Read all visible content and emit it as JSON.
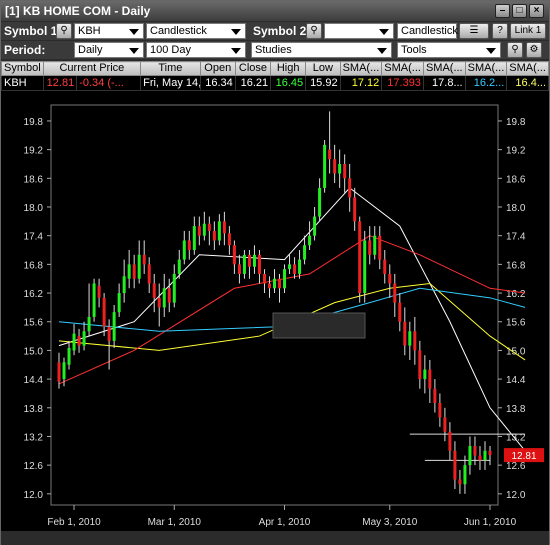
{
  "window": {
    "title": "[1] KB HOME COM - Daily"
  },
  "toolbar1": {
    "symbol1_label": "Symbol 1:",
    "symbol1_value": "KBH",
    "chart_type": "Candlestick",
    "symbol2_label": "Symbol 2:",
    "symbol2_value": "",
    "chart_type2": "Candlestick",
    "help": "?",
    "link": "Link 1"
  },
  "toolbar2": {
    "period_label": "Period:",
    "period_value": "Daily",
    "range_value": "100 Day",
    "studies": "Studies",
    "tools": "Tools"
  },
  "quote_table": {
    "headers": [
      "Symbol",
      "Current Price",
      "Time",
      "Open",
      "Close",
      "High",
      "Low",
      "SMA(...",
      "SMA(...",
      "SMA(...",
      "SMA(...",
      "SMA(..."
    ],
    "row": [
      "KBH",
      "12.81",
      "-0.34 (-...",
      "Fri, May 14,...",
      "16.34",
      "16.21",
      "16.45",
      "15.92",
      "17.12",
      "17.393",
      "17.8...",
      "16.2...",
      "16.4..."
    ],
    "colors": {
      "price": "#ff4040",
      "high": "#3cff3c",
      "sma1": "#ffff33",
      "sma2": "#ff3030",
      "sma3": "#ffffff",
      "sma4": "#33ccff",
      "sma5": "#ffff66"
    }
  },
  "chart_data": {
    "type": "candlestick",
    "title": "",
    "ylim": [
      11.85,
      20.05
    ],
    "y_ticks": [
      "19.8",
      "19.2",
      "18.6",
      "18.0",
      "17.4",
      "16.8",
      "16.2",
      "15.6",
      "15.0",
      "14.4",
      "13.8",
      "13.2",
      "12.6",
      "12.0"
    ],
    "x_ticks": [
      {
        "label": "Feb 1, 2010",
        "i": 3
      },
      {
        "label": "Mar 1, 2010",
        "i": 23
      },
      {
        "label": "Apr 1, 2010",
        "i": 45
      },
      {
        "label": "May 3, 2010",
        "i": 66
      },
      {
        "label": "Jun 1, 2010",
        "i": 86
      }
    ],
    "last_price": "12.81",
    "candles": [
      [
        14.75,
        14.35,
        14.95,
        14.2
      ],
      [
        14.4,
        14.75,
        14.85,
        14.25
      ],
      [
        14.7,
        15.05,
        15.2,
        14.6
      ],
      [
        15.0,
        15.35,
        15.55,
        14.9
      ],
      [
        15.3,
        15.1,
        15.45,
        14.95
      ],
      [
        15.1,
        15.4,
        15.6,
        15.0
      ],
      [
        15.4,
        15.7,
        16.4,
        15.3
      ],
      [
        15.7,
        16.4,
        16.5,
        15.6
      ],
      [
        16.35,
        16.1,
        16.5,
        15.9
      ],
      [
        16.1,
        15.5,
        16.2,
        15.3
      ],
      [
        15.5,
        15.2,
        15.65,
        14.6
      ],
      [
        15.2,
        15.8,
        15.95,
        15.05
      ],
      [
        15.8,
        16.2,
        16.4,
        15.7
      ],
      [
        16.2,
        16.55,
        16.9,
        16.0
      ],
      [
        16.5,
        16.8,
        17.1,
        16.3
      ],
      [
        16.8,
        16.5,
        17.0,
        16.3
      ],
      [
        16.5,
        17.0,
        17.3,
        16.4
      ],
      [
        17.0,
        16.8,
        17.3,
        16.6
      ],
      [
        16.8,
        16.4,
        16.95,
        16.2
      ],
      [
        16.4,
        16.1,
        16.6,
        15.8
      ],
      [
        16.1,
        15.9,
        16.4,
        15.5
      ],
      [
        15.9,
        16.3,
        16.6,
        15.7
      ],
      [
        16.3,
        16.0,
        16.5,
        15.8
      ],
      [
        16.0,
        16.6,
        16.8,
        15.9
      ],
      [
        16.6,
        16.9,
        17.1,
        16.5
      ],
      [
        16.9,
        17.3,
        17.5,
        16.8
      ],
      [
        17.3,
        17.1,
        17.5,
        16.9
      ],
      [
        17.1,
        17.6,
        17.8,
        17.0
      ],
      [
        17.6,
        17.4,
        17.8,
        17.2
      ],
      [
        17.4,
        17.65,
        17.9,
        17.3
      ],
      [
        17.65,
        17.5,
        17.8,
        17.2
      ],
      [
        17.5,
        17.3,
        17.7,
        17.1
      ],
      [
        17.3,
        17.7,
        17.85,
        17.2
      ],
      [
        17.7,
        17.45,
        17.9,
        17.2
      ],
      [
        17.45,
        17.2,
        17.6,
        17.0
      ],
      [
        17.2,
        16.8,
        17.3,
        16.6
      ],
      [
        16.8,
        16.6,
        17.0,
        16.4
      ],
      [
        16.6,
        17.0,
        17.1,
        16.5
      ],
      [
        17.0,
        16.75,
        17.1,
        16.5
      ],
      [
        16.75,
        17.0,
        17.2,
        16.6
      ],
      [
        17.0,
        16.6,
        17.1,
        16.4
      ],
      [
        16.6,
        16.4,
        16.7,
        16.2
      ],
      [
        16.4,
        16.3,
        16.55,
        16.1
      ],
      [
        16.3,
        16.5,
        16.7,
        16.2
      ],
      [
        16.5,
        16.3,
        16.6,
        16.0
      ],
      [
        16.3,
        16.7,
        16.8,
        16.2
      ],
      [
        16.7,
        16.8,
        17.0,
        16.6
      ],
      [
        16.8,
        16.6,
        16.95,
        16.5
      ],
      [
        16.6,
        16.9,
        17.1,
        16.5
      ],
      [
        16.9,
        17.2,
        17.4,
        16.8
      ],
      [
        17.2,
        17.4,
        17.7,
        17.1
      ],
      [
        17.4,
        17.8,
        18.0,
        17.3
      ],
      [
        17.8,
        18.4,
        18.6,
        17.7
      ],
      [
        18.4,
        19.3,
        19.4,
        18.3
      ],
      [
        19.2,
        19.0,
        20.0,
        18.7
      ],
      [
        19.0,
        18.7,
        19.3,
        18.5
      ],
      [
        18.7,
        18.9,
        19.2,
        18.4
      ],
      [
        18.9,
        18.6,
        19.1,
        18.3
      ],
      [
        18.6,
        18.2,
        18.9,
        17.9
      ],
      [
        18.2,
        17.7,
        18.4,
        17.5
      ],
      [
        17.7,
        16.2,
        17.8,
        16.0
      ],
      [
        16.2,
        17.3,
        17.5,
        16.0
      ],
      [
        17.3,
        17.0,
        17.6,
        16.8
      ],
      [
        17.0,
        17.4,
        17.6,
        16.9
      ],
      [
        17.4,
        16.9,
        17.6,
        16.7
      ],
      [
        16.9,
        16.6,
        17.1,
        16.4
      ],
      [
        16.6,
        16.4,
        16.8,
        16.1
      ],
      [
        16.4,
        16.0,
        16.6,
        15.7
      ],
      [
        16.0,
        15.6,
        16.2,
        15.4
      ],
      [
        15.6,
        15.1,
        15.9,
        14.9
      ],
      [
        15.1,
        15.4,
        15.6,
        14.8
      ],
      [
        15.4,
        15.0,
        15.7,
        14.7
      ],
      [
        15.0,
        14.4,
        15.2,
        14.2
      ],
      [
        14.4,
        14.6,
        14.9,
        14.1
      ],
      [
        14.6,
        14.2,
        14.8,
        13.9
      ],
      [
        14.2,
        13.9,
        14.4,
        13.7
      ],
      [
        13.9,
        13.6,
        14.1,
        13.4
      ],
      [
        13.6,
        13.3,
        13.8,
        13.1
      ],
      [
        13.3,
        12.9,
        13.5,
        12.7
      ],
      [
        12.9,
        12.3,
        13.1,
        12.1
      ],
      [
        12.3,
        12.2,
        12.5,
        12.0
      ],
      [
        12.2,
        12.6,
        12.8,
        12.0
      ],
      [
        12.6,
        13.0,
        13.2,
        12.4
      ],
      [
        13.0,
        12.8,
        13.2,
        12.6
      ],
      [
        12.8,
        12.7,
        13.0,
        12.5
      ],
      [
        12.7,
        12.9,
        13.1,
        12.5
      ],
      [
        12.9,
        12.81,
        13.0,
        12.6
      ]
    ],
    "series": [
      {
        "name": "SMA(...",
        "color": "#ffffff",
        "values": [
          [
            0,
            15.1
          ],
          [
            15,
            15.6
          ],
          [
            28,
            17.0
          ],
          [
            45,
            16.9
          ],
          [
            58,
            18.4
          ],
          [
            68,
            17.6
          ],
          [
            78,
            15.6
          ],
          [
            86,
            13.8
          ],
          [
            93,
            12.9
          ]
        ]
      },
      {
        "name": "SMA(...",
        "color": "#ffff33",
        "values": [
          [
            0,
            15.2
          ],
          [
            20,
            15.0
          ],
          [
            40,
            15.3
          ],
          [
            55,
            16.0
          ],
          [
            66,
            16.3
          ],
          [
            74,
            16.4
          ],
          [
            86,
            15.3
          ],
          [
            93,
            14.8
          ]
        ]
      },
      {
        "name": "SMA(...",
        "color": "#ff3030",
        "values": [
          [
            0,
            14.3
          ],
          [
            15,
            15.0
          ],
          [
            35,
            16.3
          ],
          [
            50,
            16.6
          ],
          [
            62,
            17.4
          ],
          [
            72,
            17.0
          ],
          [
            86,
            16.3
          ],
          [
            93,
            16.2
          ]
        ]
      },
      {
        "name": "SMA(...",
        "color": "#33ccff",
        "values": [
          [
            0,
            15.6
          ],
          [
            20,
            15.4
          ],
          [
            45,
            15.5
          ],
          [
            62,
            16.0
          ],
          [
            72,
            16.3
          ],
          [
            86,
            16.1
          ],
          [
            93,
            15.9
          ]
        ]
      }
    ],
    "annotations": [
      {
        "type": "hline",
        "y": 13.25,
        "from": 70,
        "to": 93,
        "color": "#dddddd"
      },
      {
        "type": "hline",
        "y": 12.7,
        "from": 73,
        "to": 86,
        "color": "#dddddd"
      }
    ]
  }
}
